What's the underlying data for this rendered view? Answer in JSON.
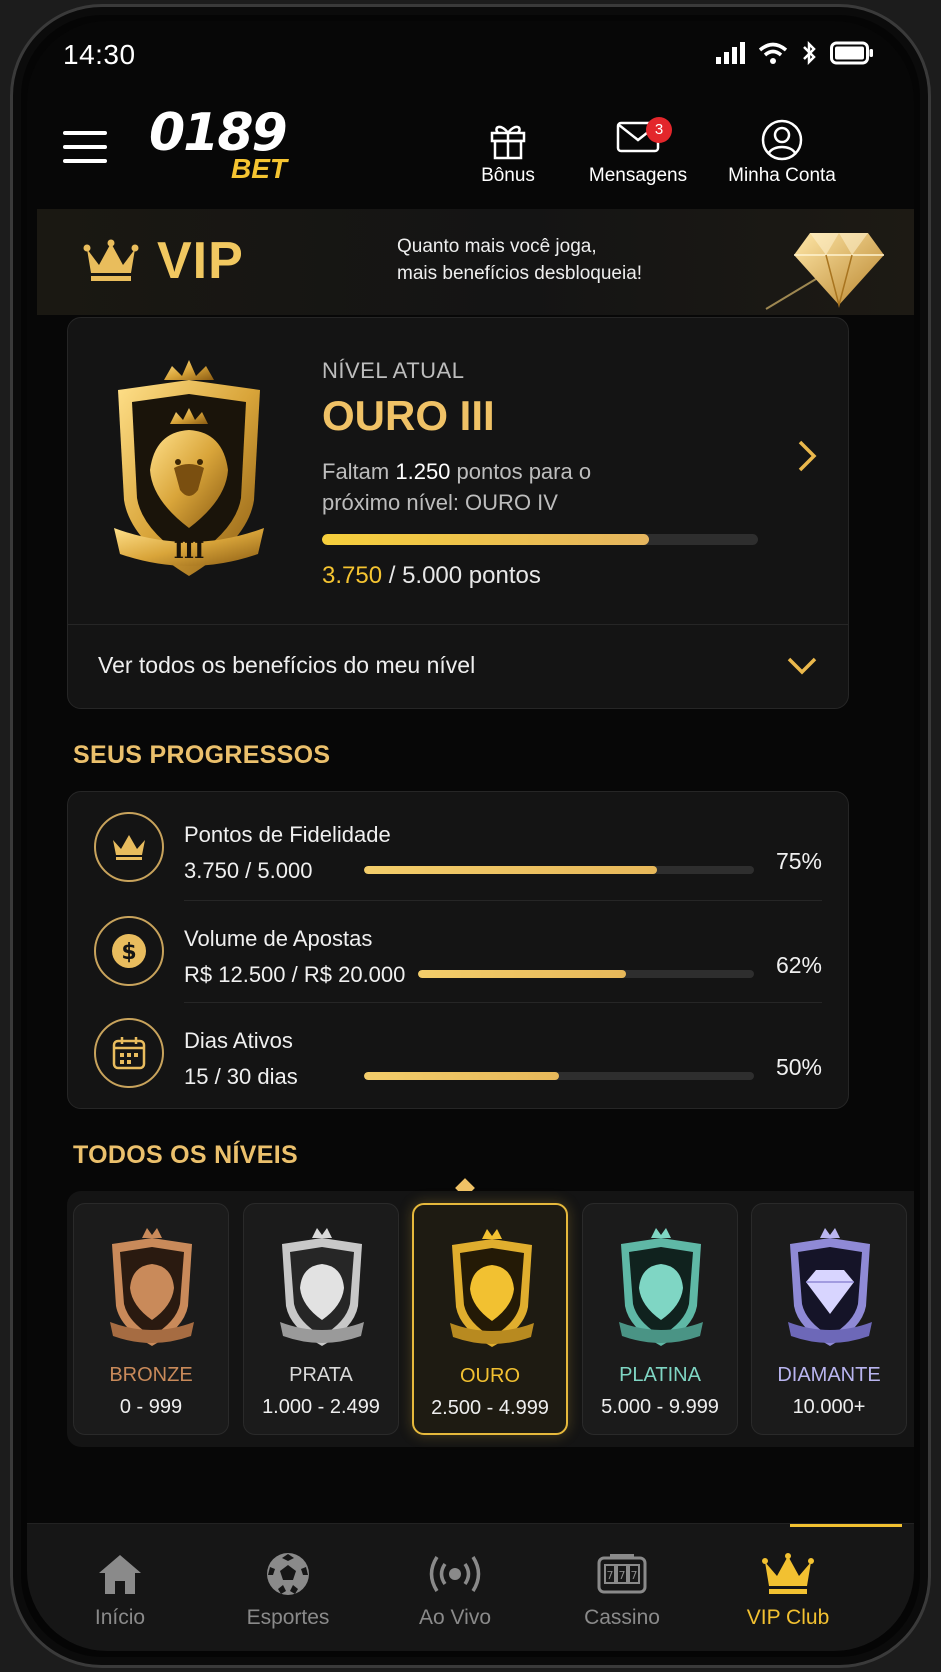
{
  "status_bar": {
    "time": "14:30"
  },
  "header": {
    "logo_number": "0189",
    "logo_bet": "BET",
    "bonus_label": "Bônus",
    "messages_label": "Mensagens",
    "messages_badge": "3",
    "account_label": "Minha Conta"
  },
  "vip_banner": {
    "title": "VIP",
    "subtitle_line1": "Quanto mais você joga,",
    "subtitle_line2": "mais benefícios desbloqueia!"
  },
  "current_level": {
    "label": "NÍVEL ATUAL",
    "name": "OURO III",
    "desc_prefix": "Faltam ",
    "desc_points": "1.250",
    "desc_suffix": " pontos para o próximo nível: OURO IV",
    "badge_numeral": "III",
    "points_current": "3.750",
    "points_total": " / 5.000 pontos",
    "progress": 0.75,
    "benefits_link": "Ver todos os benefícios do meu nível"
  },
  "progress_section": {
    "title": "SEUS PROGRESSOS",
    "items": [
      {
        "name": "Pontos de Fidelidade",
        "value": "3.750 / 5.000",
        "percent_label": "75%",
        "progress": 0.75,
        "icon": "crown-icon"
      },
      {
        "name": "Volume de Apostas",
        "value": "R$ 12.500 / R$ 20.000",
        "percent_label": "62%",
        "progress": 0.62,
        "icon": "dollar-coin-icon"
      },
      {
        "name": "Dias Ativos",
        "value": "15 / 30 dias",
        "percent_label": "50%",
        "progress": 0.5,
        "icon": "calendar-icon"
      }
    ]
  },
  "levels_section": {
    "title": "TODOS OS NÍVEIS",
    "tiers": [
      {
        "name": "BRONZE",
        "range": "0 - 999",
        "color": "#c98a5a"
      },
      {
        "name": "PRATA",
        "range": "1.000 - 2.499",
        "color": "#d9d9d9"
      },
      {
        "name": "OURO",
        "range": "2.500 - 4.999",
        "color": "#f2c131"
      },
      {
        "name": "PLATINA",
        "range": "5.000 - 9.999",
        "color": "#7fd6c4"
      },
      {
        "name": "DIAMANTE",
        "range": "10.000+",
        "color": "#b9b5f0"
      }
    ]
  },
  "bottom_nav": [
    {
      "label": "Início",
      "icon": "home-icon"
    },
    {
      "label": "Esportes",
      "icon": "soccer-ball-icon"
    },
    {
      "label": "Ao Vivo",
      "icon": "live-broadcast-icon"
    },
    {
      "label": "Cassino",
      "icon": "slot-machine-icon"
    },
    {
      "label": "VIP Club",
      "icon": "crown-icon"
    }
  ],
  "colors": {
    "accent_gold": "#f2c131",
    "background": "#070707",
    "card": "#141414"
  }
}
